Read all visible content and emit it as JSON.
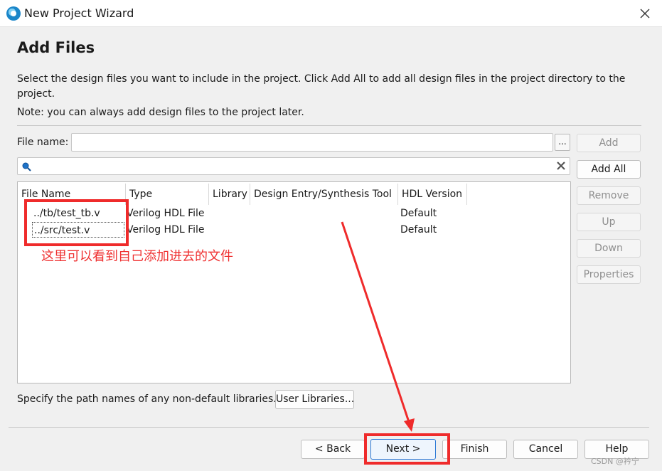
{
  "window": {
    "title": "New Project Wizard"
  },
  "page": {
    "title": "Add Files",
    "description": "Select the design files you want to include in the project. Click Add All to add all design files in the project directory to the project.",
    "note": "Note: you can always add design files to the project later."
  },
  "file_name": {
    "label": "File name:",
    "value": "",
    "browse_label": "..."
  },
  "search": {
    "value": ""
  },
  "table": {
    "columns": [
      "File Name",
      "Type",
      "Library",
      "Design Entry/Synthesis Tool",
      "HDL Version"
    ],
    "rows": [
      {
        "file_name": "../tb/test_tb.v",
        "type": "Verilog HDL File",
        "library": "",
        "tool": "",
        "hdl_version": "Default"
      },
      {
        "file_name": "../src/test.v",
        "type": "Verilog HDL File",
        "library": "",
        "tool": "",
        "hdl_version": "Default"
      }
    ]
  },
  "side_buttons": {
    "add": "Add",
    "add_all": "Add All",
    "remove": "Remove",
    "up": "Up",
    "down": "Down",
    "properties": "Properties"
  },
  "libraries": {
    "text": "Specify the path names of any non-default libraries.",
    "button": "User Libraries..."
  },
  "nav_buttons": {
    "back": "< Back",
    "next": "Next >",
    "finish": "Finish",
    "cancel": "Cancel",
    "help": "Help"
  },
  "annotation": {
    "text": "这里可以看到自己添加进去的文件",
    "color": "#ef2b2b"
  },
  "watermark": "CSDN @衿宁"
}
